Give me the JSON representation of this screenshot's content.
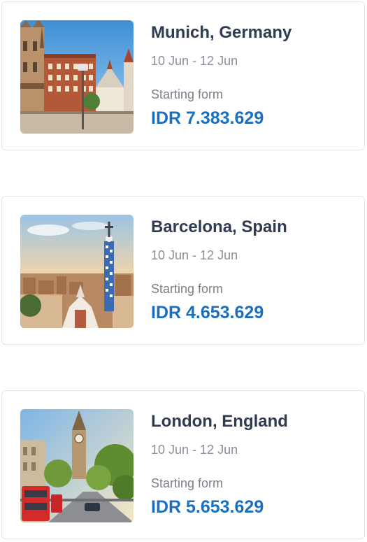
{
  "destinations": [
    {
      "city": "Munich, Germany",
      "dates": "10 Jun - 12 Jun",
      "starting_label": "Starting form",
      "price": "IDR 7.383.629",
      "image": "munich-square-photo"
    },
    {
      "city": "Barcelona, Spain",
      "dates": "10 Jun - 12 Jun",
      "starting_label": "Starting form",
      "price": "IDR 4.653.629",
      "image": "barcelona-park-guell-photo"
    },
    {
      "city": "London, England",
      "dates": "10 Jun - 12 Jun",
      "starting_label": "Starting form",
      "price": "IDR 5.653.629",
      "image": "london-big-ben-photo"
    }
  ],
  "colors": {
    "title": "#2f3b52",
    "muted": "#8a8f99",
    "price": "#1a6fbf",
    "border": "#e3e5ea"
  }
}
